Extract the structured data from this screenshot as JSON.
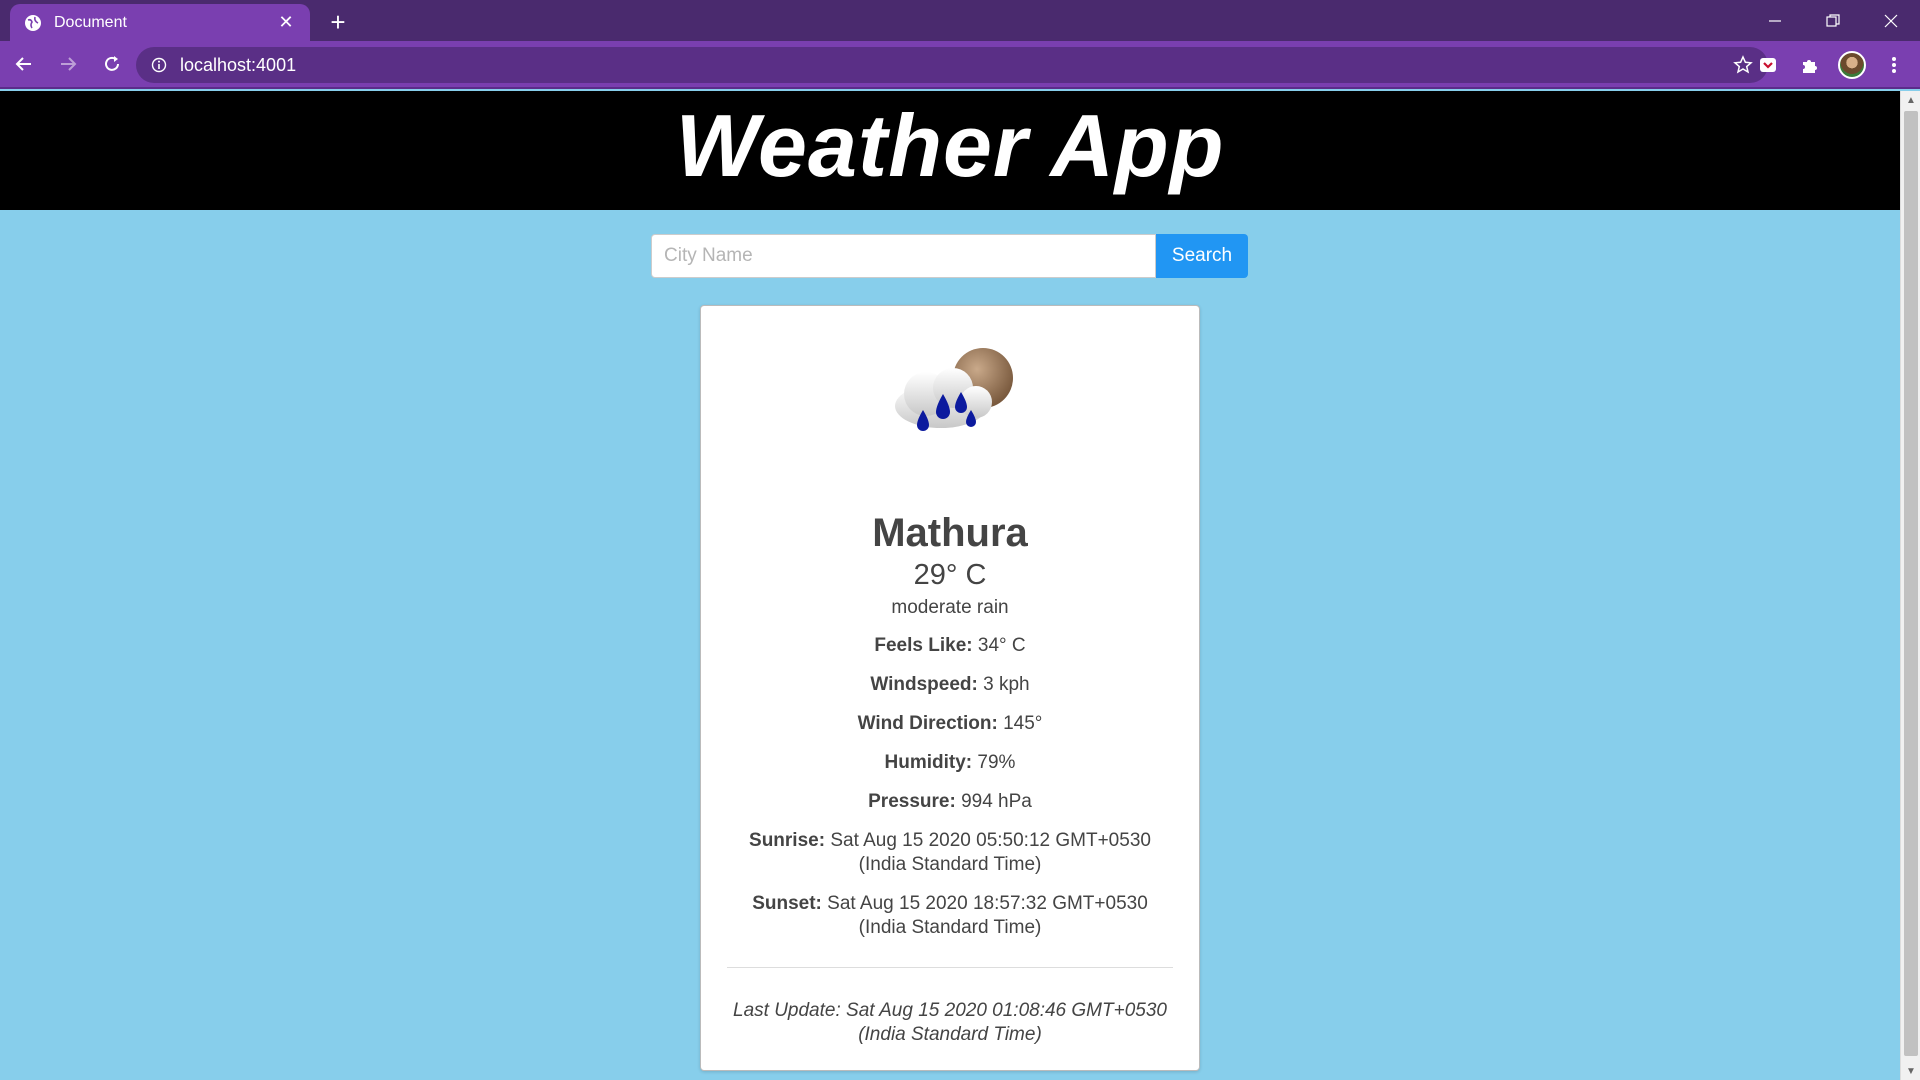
{
  "browser": {
    "tab_title": "Document",
    "url": "localhost:4001",
    "tab_close_label": "✕",
    "new_tab_label": "+"
  },
  "page": {
    "title": "Weather App"
  },
  "search": {
    "placeholder": "City Name",
    "value": "",
    "button_label": "Search"
  },
  "weather": {
    "icon": "moderate-rain-icon",
    "city": "Mathura",
    "temperature": "29° C",
    "description": "moderate rain",
    "details": [
      {
        "label": "Feels Like:",
        "value": "34° C"
      },
      {
        "label": "Windspeed:",
        "value": "3 kph"
      },
      {
        "label": "Wind Direction:",
        "value": "145°"
      },
      {
        "label": "Humidity:",
        "value": "79%"
      },
      {
        "label": "Pressure:",
        "value": "994 hPa"
      },
      {
        "label": "Sunrise:",
        "value": "Sat Aug 15 2020 05:50:12 GMT+0530 (India Standard Time)"
      },
      {
        "label": "Sunset:",
        "value": "Sat Aug 15 2020 18:57:32 GMT+0530 (India Standard Time)"
      }
    ],
    "last_update": "Last Update: Sat Aug 15 2020 01:08:46 GMT+0530 (India Standard Time)"
  },
  "colors": {
    "page_bg": "#87CEEB",
    "header_bg": "#000000",
    "button_bg": "#2196F3",
    "chrome_tab": "#7a3fb0",
    "chrome_strip": "#4a2a6e"
  }
}
